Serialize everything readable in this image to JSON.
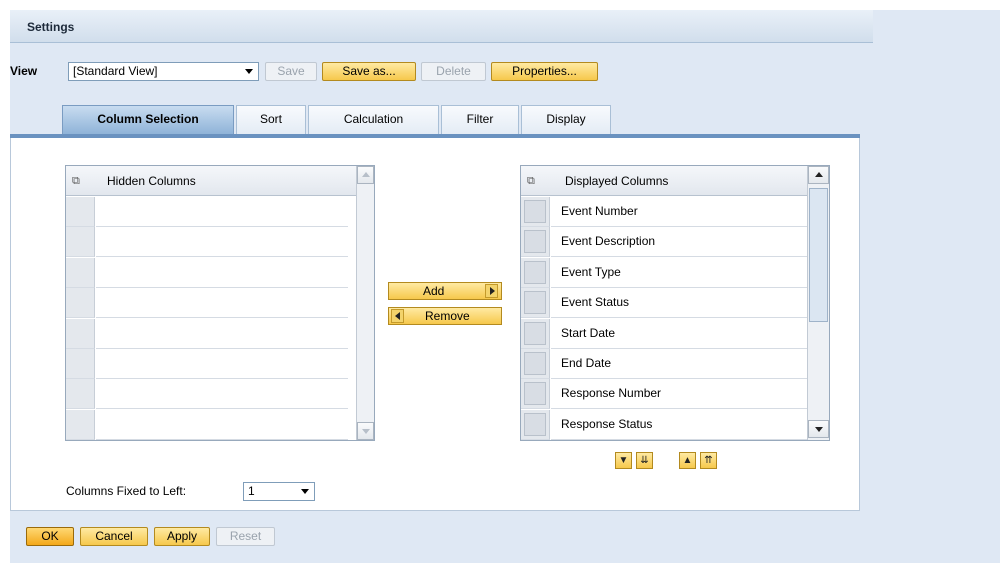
{
  "dialog": {
    "title": "Settings"
  },
  "view": {
    "label": "View",
    "selected": "[Standard View]",
    "buttons": {
      "save": "Save",
      "save_as": "Save as...",
      "delete": "Delete",
      "properties": "Properties..."
    }
  },
  "tabs": [
    "Column Selection",
    "Sort",
    "Calculation",
    "Filter",
    "Display"
  ],
  "hidden_columns": {
    "header": "Hidden Columns",
    "rows": [
      "",
      "",
      "",
      "",
      "",
      "",
      "",
      ""
    ]
  },
  "move_buttons": {
    "add": "Add",
    "remove": "Remove"
  },
  "displayed_columns": {
    "header": "Displayed Columns",
    "rows": [
      "Event Number",
      "Event Description",
      "Event Type",
      "Event Status",
      "Start Date",
      "End Date",
      "Response Number",
      "Response Status"
    ]
  },
  "fixed_columns": {
    "label": "Columns Fixed to Left:",
    "value": "1"
  },
  "footer": {
    "ok": "OK",
    "cancel": "Cancel",
    "apply": "Apply",
    "reset": "Reset"
  },
  "colors": {
    "panel_bg": "#dfe8f4",
    "button_gold": "#f6c84c",
    "tab_active": "#8fb3d8",
    "tab_line": "#6a92c0"
  }
}
